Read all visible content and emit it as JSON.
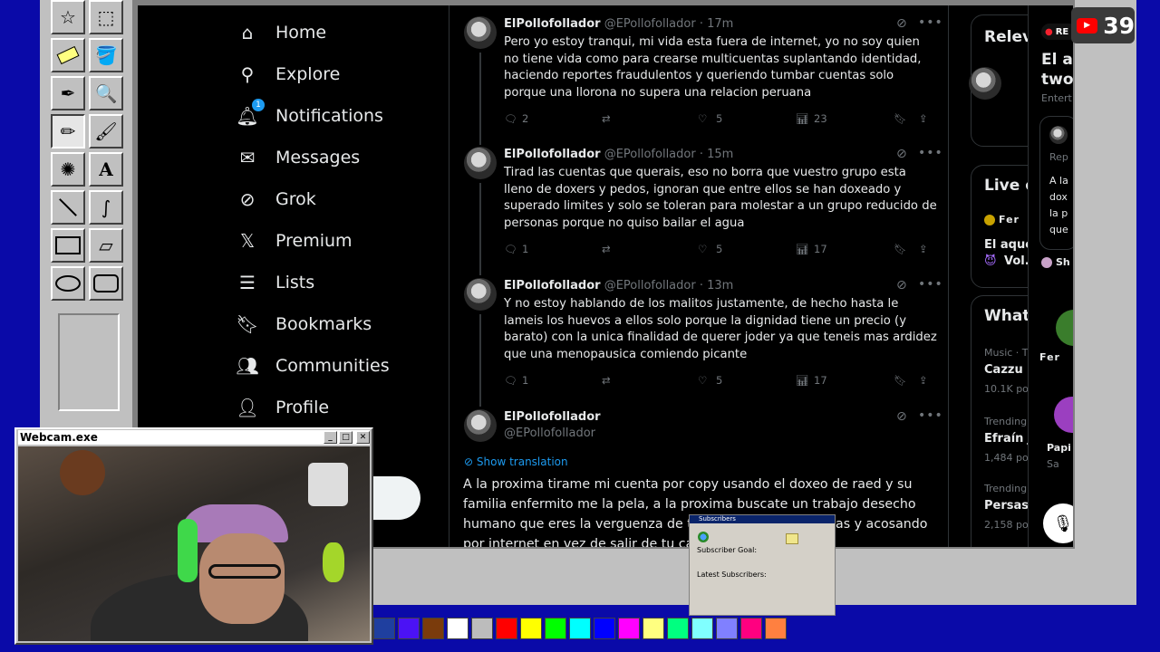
{
  "overlay": {
    "subscriber_count": "39"
  },
  "webcam": {
    "title": "Webcam.exe"
  },
  "subs_widget": {
    "title": "Subscribers",
    "goal_label": "Subscriber Goal:",
    "latest_label": "Latest Subscribers:"
  },
  "nav": {
    "items": [
      {
        "label": "Home",
        "icon": "home-icon"
      },
      {
        "label": "Explore",
        "icon": "search-icon"
      },
      {
        "label": "Notifications",
        "icon": "bell-icon",
        "badge": "1"
      },
      {
        "label": "Messages",
        "icon": "envelope-icon"
      },
      {
        "label": "Grok",
        "icon": "grok-icon"
      },
      {
        "label": "Premium",
        "icon": "x-logo-icon"
      },
      {
        "label": "Lists",
        "icon": "list-icon"
      },
      {
        "label": "Bookmarks",
        "icon": "bookmark-icon"
      },
      {
        "label": "Communities",
        "icon": "people-icon"
      },
      {
        "label": "Profile",
        "icon": "person-icon"
      }
    ]
  },
  "tweets": [
    {
      "name": "ElPollofollador",
      "handle": "@EPollofollador",
      "time": "· 17m",
      "text": "Pero yo estoy tranqui, mi vida esta fuera de internet, yo no soy quien no tiene vida como para crearse multicuentas suplantando identidad, haciendo reportes fraudulentos y queriendo tumbar cuentas solo porque una llorona no supera una relacion peruana",
      "replies": "2",
      "reposts": "",
      "likes": "5",
      "views": "23"
    },
    {
      "name": "ElPollofollador",
      "handle": "@EPollofollador",
      "time": "· 15m",
      "text": "Tirad las cuentas que querais, eso no borra que vuestro grupo esta lleno de doxers y pedos, ignoran que entre ellos se han doxeado y superado limites y solo se toleran para molestar a un grupo reducido de personas porque no quiso bailar el agua",
      "replies": "1",
      "reposts": "",
      "likes": "5",
      "views": "17"
    },
    {
      "name": "ElPollofollador",
      "handle": "@EPollofollador",
      "time": "· 13m",
      "text": "Y no estoy hablando de los malitos justamente, de hecho hasta le lameis los huevos a ellos solo porque la dignidad tiene un precio (y barato) con la unica finalidad de querer joder ya que teneis mas ardidez que una menopausica comiendo picante",
      "replies": "1",
      "reposts": "",
      "likes": "5",
      "views": "17"
    }
  ],
  "main_tweet": {
    "name": "ElPollofollador",
    "handle": "@EPollofollador",
    "show_translation": "Show translation",
    "text": "A la proxima tirame mi cuenta por copy usando el doxeo de raed y su familia enfermito me la pela, a la proxima buscate un trabajo desecho humano que eres la verguenza de t",
    "text_tail": "as y acosando",
    "text_line4": "por internet en vez de salir de tu ca"
  },
  "right": {
    "card1": {
      "title": "Relev",
      "live": "RE",
      "headline1": "El ac",
      "headline2": "two",
      "cat": "Entert",
      "rep": "Rep",
      "snippet": [
        "A la",
        "dox",
        "la p",
        "que"
      ],
      "sh": "Sh"
    },
    "live": {
      "title": "Live o",
      "fer": "Fer",
      "line1": "El aque",
      "line2": "Vol."
    },
    "whats": {
      "title": "What",
      "items": [
        {
          "meta": "Music · T",
          "name": "Cazzu",
          "count": "10.1K pos"
        },
        {
          "meta": "Trending",
          "name": "Efraín J",
          "count": "1,484 po"
        },
        {
          "meta": "Trending",
          "name": "Persas",
          "count": "2,158 po"
        }
      ]
    },
    "side": {
      "fer": "Fer",
      "papi": "Papi",
      "sa": "Sa"
    }
  },
  "palette": [
    "#1f3f9f",
    "#4b12f5",
    "#7a3b0c",
    "#ffffff",
    "#bcbcbc",
    "#ff0000",
    "#ffff00",
    "#00ff00",
    "#00ffff",
    "#0000ff",
    "#ff00ff",
    "#ffff80",
    "#00ff80",
    "#80ffff",
    "#8080ff",
    "#ff0080",
    "#ff8040"
  ]
}
